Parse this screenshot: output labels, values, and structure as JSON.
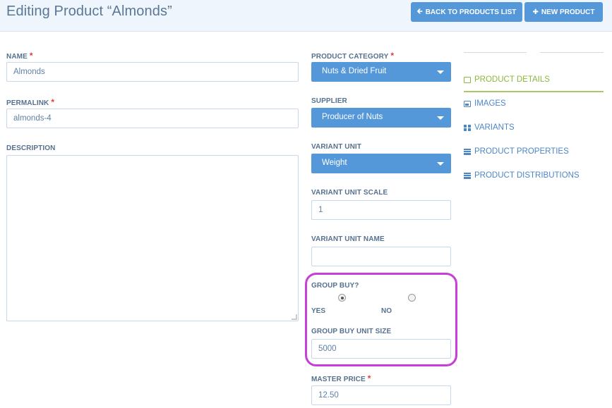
{
  "header": {
    "title": "Editing Product “Almonds”",
    "back_button": {
      "icon": "arrow-left-icon",
      "label": "BACK TO PRODUCTS LIST"
    },
    "new_button": {
      "icon": "plus-icon",
      "label": "NEW PRODUCT"
    }
  },
  "form": {
    "name": {
      "label": "NAME",
      "required_mark": "*",
      "value": "Almonds"
    },
    "permalink": {
      "label": "PERMALINK",
      "required_mark": "*",
      "value": "almonds-4"
    },
    "description": {
      "label": "DESCRIPTION",
      "value": ""
    },
    "product_category": {
      "label": "PRODUCT CATEGORY",
      "required_mark": "*",
      "value": "Nuts & Dried Fruit"
    },
    "supplier": {
      "label": "SUPPLIER",
      "value": "Producer of Nuts"
    },
    "variant_unit": {
      "label": "VARIANT UNIT",
      "value": "Weight"
    },
    "variant_unit_scale": {
      "label": "VARIANT UNIT SCALE",
      "value": "1"
    },
    "variant_unit_name": {
      "label": "VARIANT UNIT NAME",
      "value": ""
    },
    "group_buy": {
      "label": "GROUP BUY?",
      "yes_label": "YES",
      "no_label": "NO",
      "selected": "YES"
    },
    "group_buy_unit_size": {
      "label": "GROUP BUY UNIT SIZE",
      "value": "5000"
    },
    "master_price": {
      "label": "MASTER PRICE",
      "required_mark": "*",
      "value": "12.50"
    }
  },
  "sidebar": {
    "items": [
      {
        "label": "PRODUCT DETAILS",
        "icon": "edit-icon",
        "active": true
      },
      {
        "label": "IMAGES",
        "icon": "image-icon",
        "active": false
      },
      {
        "label": "VARIANTS",
        "icon": "grid-icon",
        "active": false
      },
      {
        "label": "PRODUCT PROPERTIES",
        "icon": "list-icon",
        "active": false
      },
      {
        "label": "PRODUCT DISTRIBUTIONS",
        "icon": "list-icon",
        "active": false
      }
    ]
  },
  "colors": {
    "primary": "#5498da",
    "active": "#8cb83e",
    "highlight": "#c63fd6",
    "required": "#e03c3c"
  }
}
